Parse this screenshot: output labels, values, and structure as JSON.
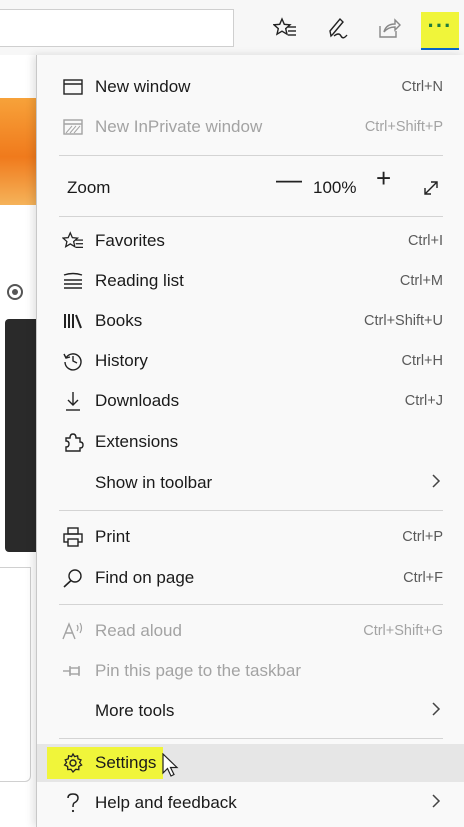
{
  "toolbar": {
    "favorites_icon": "star-list-icon",
    "pen_icon": "pen-icon",
    "share_icon": "share-icon",
    "more_label": "···",
    "highlight_color": "#f0f53a"
  },
  "menu": {
    "new_window": {
      "label": "New window",
      "shortcut": "Ctrl+N",
      "icon": "window-icon"
    },
    "new_inprivate": {
      "label": "New InPrivate window",
      "shortcut": "Ctrl+Shift+P",
      "icon": "inprivate-icon",
      "disabled": true
    },
    "zoom": {
      "label": "Zoom",
      "minus": "—",
      "value": "100%",
      "plus": "+",
      "fullscreen_icon": "fullscreen-icon"
    },
    "favorites": {
      "label": "Favorites",
      "shortcut": "Ctrl+I",
      "icon": "star-list-icon"
    },
    "reading_list": {
      "label": "Reading list",
      "shortcut": "Ctrl+M",
      "icon": "reading-list-icon"
    },
    "books": {
      "label": "Books",
      "shortcut": "Ctrl+Shift+U",
      "icon": "books-icon"
    },
    "history": {
      "label": "History",
      "shortcut": "Ctrl+H",
      "icon": "history-icon"
    },
    "downloads": {
      "label": "Downloads",
      "shortcut": "Ctrl+J",
      "icon": "download-icon"
    },
    "extensions": {
      "label": "Extensions",
      "icon": "puzzle-icon"
    },
    "show_in_toolbar": {
      "label": "Show in toolbar",
      "chevron": "›"
    },
    "print": {
      "label": "Print",
      "shortcut": "Ctrl+P",
      "icon": "printer-icon"
    },
    "find_on_page": {
      "label": "Find on page",
      "shortcut": "Ctrl+F",
      "icon": "search-icon"
    },
    "read_aloud": {
      "label": "Read aloud",
      "shortcut": "Ctrl+Shift+G",
      "icon": "read-aloud-icon",
      "disabled": true
    },
    "pin_taskbar": {
      "label": "Pin this page to the taskbar",
      "icon": "pin-icon",
      "disabled": true
    },
    "more_tools": {
      "label": "More tools",
      "chevron": "›"
    },
    "settings": {
      "label": "Settings",
      "icon": "gear-icon",
      "highlighted": true
    },
    "help": {
      "label": "Help and feedback",
      "icon": "question-icon",
      "chevron": "›"
    }
  }
}
